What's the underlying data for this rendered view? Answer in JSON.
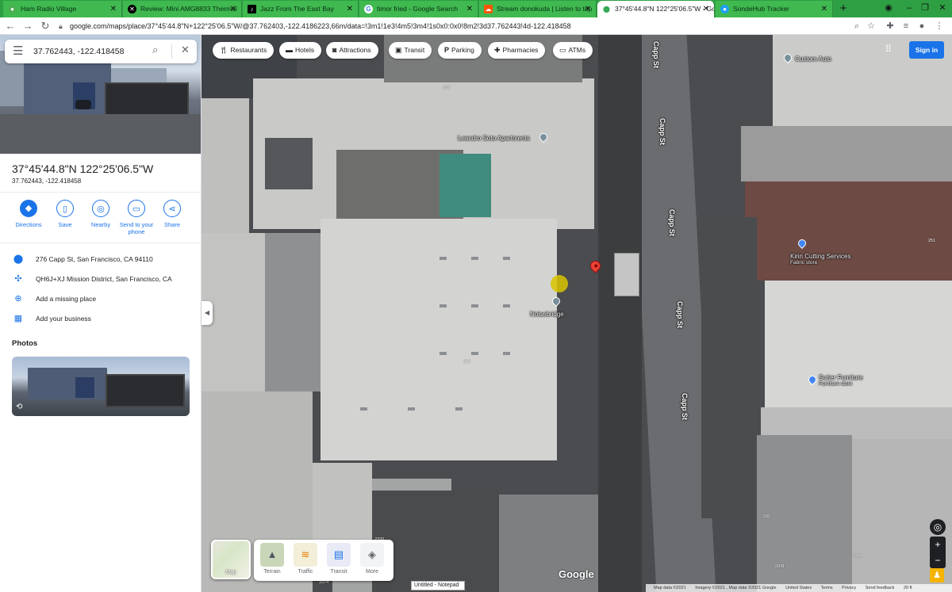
{
  "browser": {
    "tabs": [
      {
        "title": "Ham Radio Village",
        "icon_color": "#4caf50",
        "icon": "circle-icon"
      },
      {
        "title": "Review: Mini AMG8833 Thermal",
        "icon_color": "#000000",
        "icon": "x-logo-icon"
      },
      {
        "title": "Jazz From The East Bay",
        "icon_color": "#000000",
        "icon": "album-icon"
      },
      {
        "title": "timor fried - Google Search",
        "icon_color": "#4285f4",
        "icon": "google-icon"
      },
      {
        "title": "Stream donokuda | Listen to top",
        "icon_color": "#ff5500",
        "icon": "soundcloud-icon"
      },
      {
        "title": "37°45'44.8\"N 122°25'06.5\"W - Go",
        "icon_color": "#34a853",
        "icon": "maps-pin-icon"
      },
      {
        "title": "SondeHub Tracker",
        "icon_color": "#1da1f2",
        "icon": "balloon-icon"
      }
    ],
    "new_tab": "+",
    "url": "google.com/maps/place/37°45'44.8\"N+122°25'06.5\"W/@37.762403,-122.4186223,66m/data=!3m1!1e3!4m5!3m4!1s0x0:0x0!8m2!3d37.762443!4d-122.418458"
  },
  "search": {
    "value": "37.762443, -122.418458"
  },
  "place": {
    "title": "37°45'44.8\"N 122°25'06.5\"W",
    "decimal": "37.762443, -122.418458"
  },
  "actions": [
    {
      "label": "Directions",
      "icon": "directions-icon",
      "primary": true
    },
    {
      "label": "Save",
      "icon": "bookmark-icon",
      "primary": false
    },
    {
      "label": "Nearby",
      "icon": "nearby-icon",
      "primary": false
    },
    {
      "label": "Send to your phone",
      "icon": "phone-icon",
      "primary": false
    },
    {
      "label": "Share",
      "icon": "share-icon",
      "primary": false
    }
  ],
  "info": {
    "address": "276 Capp St, San Francisco, CA 94110",
    "pluscode": "QH6J+XJ Mission District, San Francisco, CA",
    "add_place": "Add a missing place",
    "add_business": "Add your business"
  },
  "photos_heading": "Photos",
  "map": {
    "chips": [
      {
        "label": "Restaurants",
        "icon": "fork-knife-icon"
      },
      {
        "label": "Hotels",
        "icon": "bed-icon"
      },
      {
        "label": "Attractions",
        "icon": "camera-icon"
      },
      {
        "label": "Transit",
        "icon": "bus-icon"
      },
      {
        "label": "Parking",
        "icon": "parking-icon"
      },
      {
        "label": "Pharmacies",
        "icon": "pharmacy-icon"
      },
      {
        "label": "ATMs",
        "icon": "atm-icon"
      }
    ],
    "sign_in": "Sign in",
    "streets": [
      "Capp St",
      "Capp St",
      "Capp St",
      "Capp St",
      "Capp St"
    ],
    "pois": [
      {
        "name": "Custom Auto",
        "sub": ""
      },
      {
        "name": "Leandro Soto Apartments",
        "sub": ""
      },
      {
        "name": "Noisebridge",
        "sub": ""
      },
      {
        "name": "Kirin Cutting Services",
        "sub": "Fabric store"
      },
      {
        "name": "Sutter Furniture",
        "sub": "Furniture store"
      }
    ],
    "plot_numbers": [
      "252",
      "272",
      "251",
      "291",
      "2370",
      "3374",
      "2941",
      "3342"
    ],
    "layers": {
      "current": "Map",
      "options": [
        {
          "label": "Terrain",
          "icon": "terrain-icon"
        },
        {
          "label": "Traffic",
          "icon": "traffic-icon"
        },
        {
          "label": "Transit",
          "icon": "transit-icon"
        },
        {
          "label": "More",
          "icon": "layers-icon"
        }
      ]
    },
    "google_logo": "Google",
    "notepad": "Untitled - Notepad",
    "footer": [
      "Map data ©2021",
      "Imagery ©2021 , Map data ©2021 Google",
      "United States",
      "Terms",
      "Privacy",
      "Send feedback",
      "20 ft"
    ]
  }
}
